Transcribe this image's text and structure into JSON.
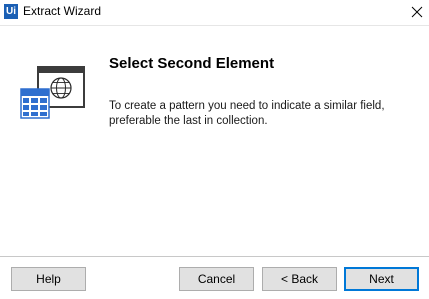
{
  "window": {
    "title": "Extract Wizard",
    "logo_text": "Ui",
    "close_glyph": "✕"
  },
  "content": {
    "heading": "Select Second Element",
    "description": "To create a pattern you need to indicate a similar field, preferable the last in collection.",
    "illustration_icon": "extract-table-globe-icon"
  },
  "footer": {
    "help_label": "Help",
    "cancel_label": "Cancel",
    "back_label": "< Back",
    "next_label": "Next"
  },
  "colors": {
    "accent": "#0078d7",
    "logo": "#1a5fb4",
    "button_bg": "#e1e1e1"
  }
}
